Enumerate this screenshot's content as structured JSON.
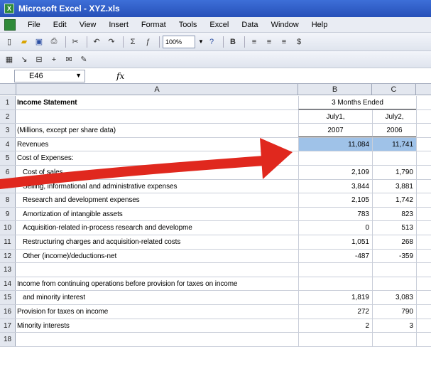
{
  "window": {
    "title": "Microsoft Excel - XYZ.xls",
    "app_badge": "X"
  },
  "menu": [
    "File",
    "Edit",
    "View",
    "Insert",
    "Format",
    "Tools",
    "Excel",
    "Data",
    "Window",
    "Help"
  ],
  "toolbar": {
    "zoom": "100%"
  },
  "formula_bar": {
    "cell_ref": "E46",
    "fx": "fx"
  },
  "columns": [
    "A",
    "B",
    "C"
  ],
  "rows": [
    {
      "n": "1",
      "a": "Income Statement",
      "bold": true,
      "merged": "3 Months Ended"
    },
    {
      "n": "2",
      "a": "",
      "b": "July1,",
      "c": "July2,"
    },
    {
      "n": "3",
      "a": "(Millions, except per share data)",
      "b": "2007",
      "c": "2006"
    },
    {
      "n": "4",
      "a": "Revenues",
      "b": "11,084",
      "c": "11,741",
      "selected": true
    },
    {
      "n": "5",
      "a": "Cost of Expenses:",
      "b": "",
      "c": ""
    },
    {
      "n": "6",
      "a": "Cost of sales",
      "b": "2,109",
      "c": "1,790",
      "indent": true
    },
    {
      "n": "7",
      "a": "Selling, informational and administrative expenses",
      "b": "3,844",
      "c": "3,881",
      "indent": true
    },
    {
      "n": "8",
      "a": "Research and development expenses",
      "b": "2,105",
      "c": "1,742",
      "indent": true
    },
    {
      "n": "9",
      "a": "Amortization of intangible assets",
      "b": "783",
      "c": "823",
      "indent": true
    },
    {
      "n": "10",
      "a": "Acquisition-related in-process research and developme",
      "b": "0",
      "c": "513",
      "indent": true
    },
    {
      "n": "11",
      "a": "Restructuring charges and acquisition-related costs",
      "b": "1,051",
      "c": "268",
      "indent": true
    },
    {
      "n": "12",
      "a": "Other (income)/deductions-net",
      "b": "-487",
      "c": "-359",
      "indent": true
    },
    {
      "n": "13",
      "a": "",
      "b": "",
      "c": ""
    },
    {
      "n": "14",
      "a": "Income from continuing operations before provision for taxes on income",
      "b": "",
      "c": ""
    },
    {
      "n": "15",
      "a": "and minority interest",
      "b": "1,819",
      "c": "3,083",
      "indent": true
    },
    {
      "n": "16",
      "a": "Provision for taxes on income",
      "b": "272",
      "c": "790"
    },
    {
      "n": "17",
      "a": "Minority interests",
      "b": "2",
      "c": "3"
    },
    {
      "n": "18",
      "a": "",
      "b": "",
      "c": ""
    }
  ],
  "colors": {
    "arrow": "#e0281e",
    "selection": "#9fc2e8",
    "titlebar": "#2f5fcf"
  }
}
